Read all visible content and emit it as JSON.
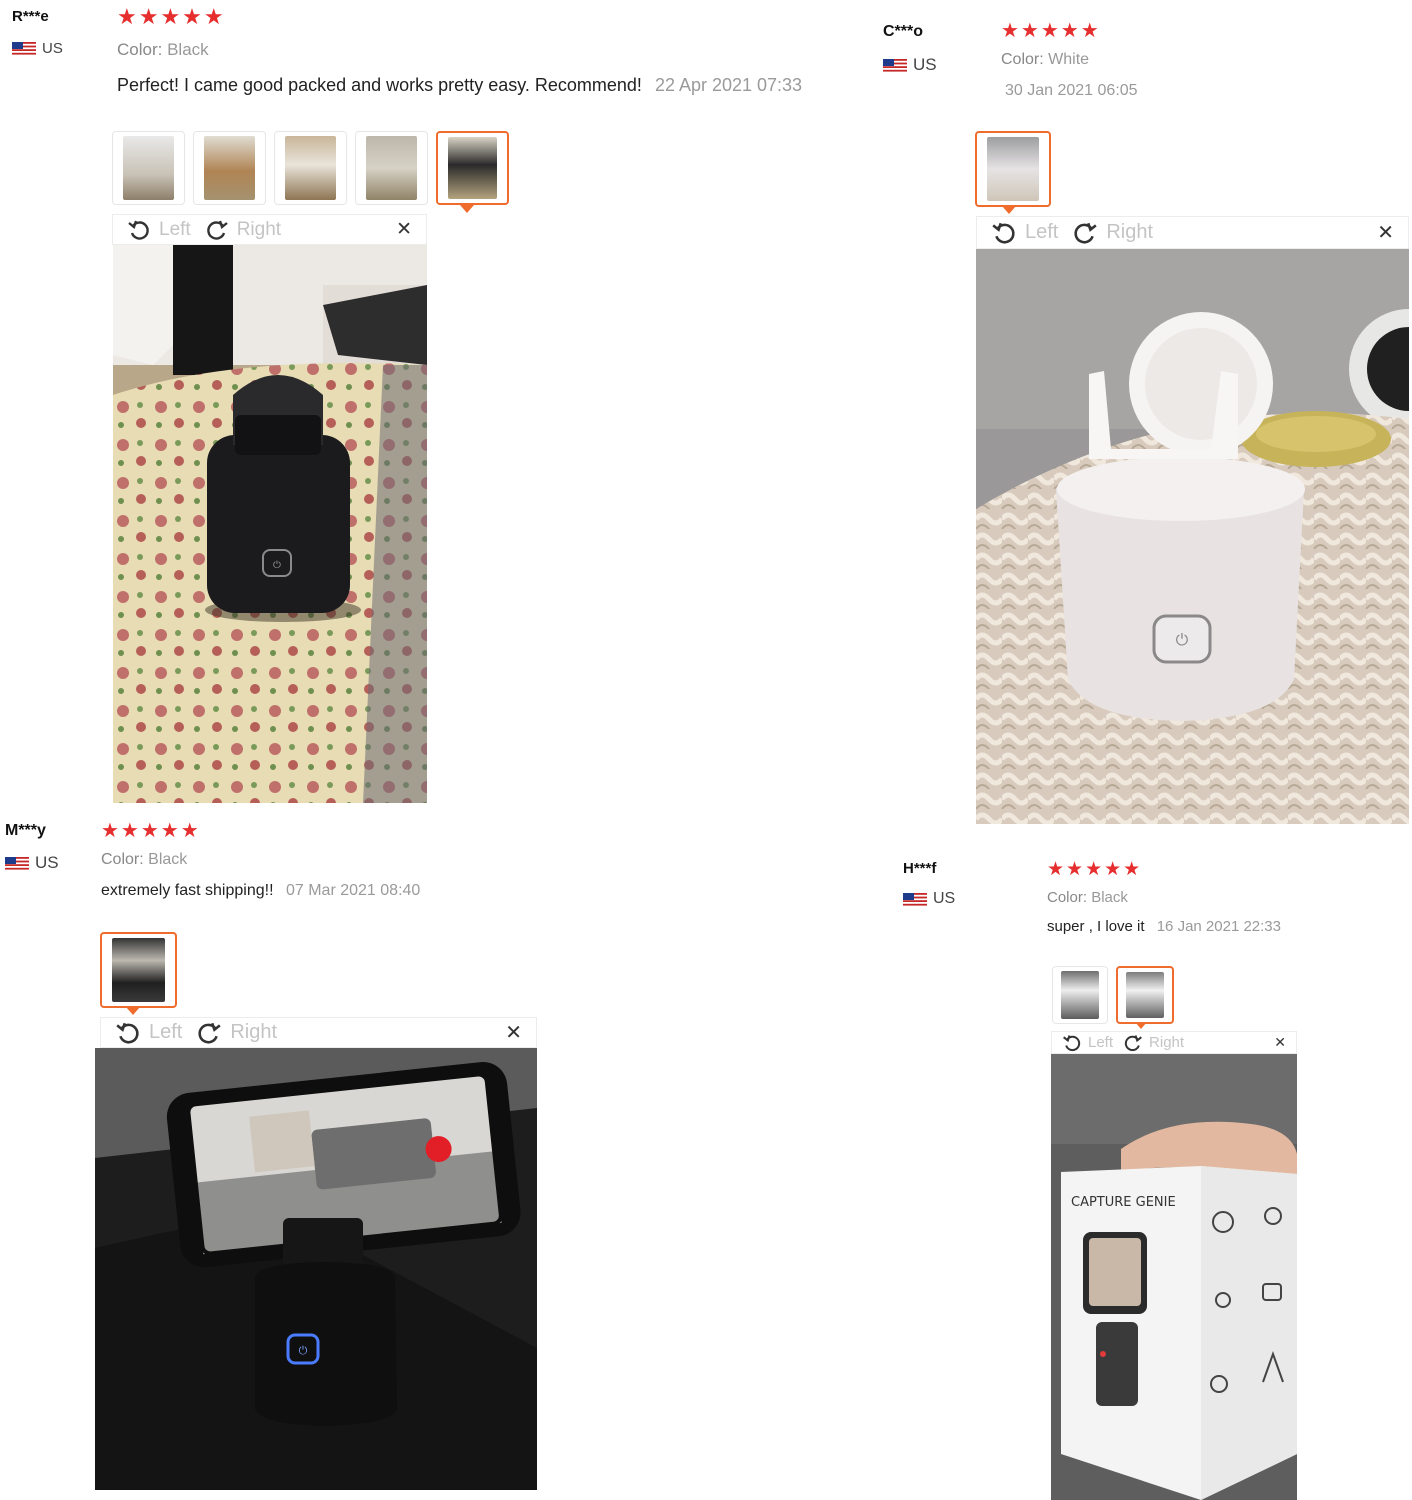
{
  "controls": {
    "left_label": "Left",
    "right_label": "Right",
    "close_glyph": "✕"
  },
  "reviews": [
    {
      "user": "R***e",
      "country": "US",
      "stars": "★★★★★",
      "rating": 5,
      "color_label": "Color:",
      "color_value": "Black",
      "comment": "Perfect! I came good packed and works pretty easy. Recommend!",
      "date": "22 Apr 2021 07:33",
      "thumbnail_count": 5,
      "selected_thumbnail": 5
    },
    {
      "user": "C***o",
      "country": "US",
      "stars": "★★★★★",
      "rating": 5,
      "color_label": "Color:",
      "color_value": "White",
      "comment": "",
      "date": "30 Jan 2021 06:05",
      "thumbnail_count": 1,
      "selected_thumbnail": 1
    },
    {
      "user": "M***y",
      "country": "US",
      "stars": "★★★★★",
      "rating": 5,
      "color_label": "Color:",
      "color_value": "Black",
      "comment": "extremely fast shipping!!",
      "date": "07 Mar 2021 08:40",
      "thumbnail_count": 1,
      "selected_thumbnail": 1
    },
    {
      "user": "H***f",
      "country": "US",
      "stars": "★★★★★",
      "rating": 5,
      "color_label": "Color:",
      "color_value": "Black",
      "comment": "super , I love it",
      "date": "16 Jan 2021 22:33",
      "thumbnail_count": 2,
      "selected_thumbnail": 2
    }
  ],
  "photo_texts": {
    "box_brand": "CAPTURE GENIE"
  },
  "colors": {
    "star": "#e62e2e",
    "selected_border": "#ef6c2c",
    "muted_text": "#9a9a9a"
  }
}
